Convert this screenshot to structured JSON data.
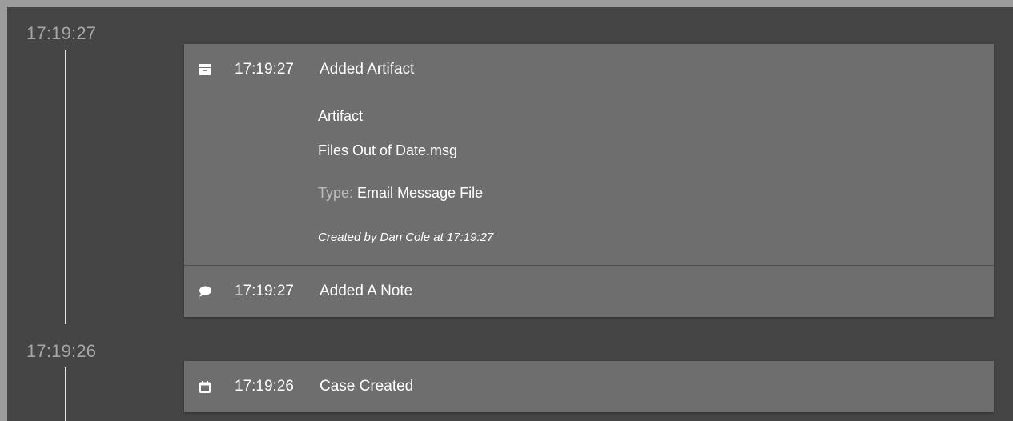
{
  "groups": [
    {
      "time": "17:19:27",
      "events": [
        {
          "icon": "archive-icon",
          "time": "17:19:27",
          "title": "Added Artifact",
          "detail": {
            "heading": "Artifact",
            "name": "Files Out of Date.msg",
            "type_label": "Type:",
            "type_value": "Email Message File",
            "created": "Created by Dan Cole at 17:19:27"
          }
        },
        {
          "icon": "comment-icon",
          "time": "17:19:27",
          "title": "Added A Note"
        }
      ]
    },
    {
      "time": "17:19:26",
      "events": [
        {
          "icon": "calendar-icon",
          "time": "17:19:26",
          "title": "Case Created"
        }
      ]
    }
  ],
  "colors": {
    "outer": "#9c9c9c",
    "background": "#454545",
    "card": "#6e6e6e",
    "group_time": "#a6a6a6",
    "line": "#e4e4e4",
    "text": "#ffffff",
    "muted_label": "#bdbdbd"
  }
}
